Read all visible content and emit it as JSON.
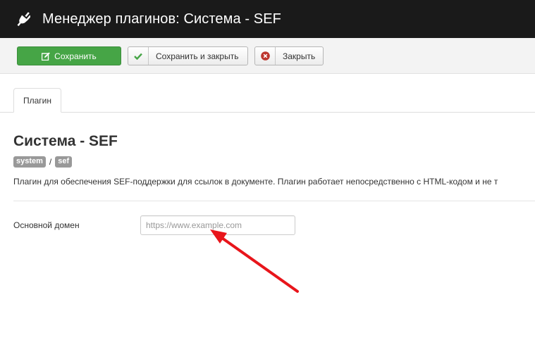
{
  "header": {
    "title": "Менеджер плагинов: Система - SEF",
    "icon": "plug-icon"
  },
  "toolbar": {
    "save_label": "Сохранить",
    "save_close_label": "Сохранить и закрыть",
    "close_label": "Закрыть"
  },
  "tabs": [
    {
      "label": "Плагин"
    }
  ],
  "plugin": {
    "title": "Система - SEF",
    "folder_tag": "system",
    "separator": "/",
    "element_tag": "sef",
    "description": "Плагин для обеспечения SEF-поддержки для ссылок в документе. Плагин работает непосредственно с HTML-кодом и не т"
  },
  "form": {
    "domain_label": "Основной домен",
    "domain_value": "",
    "domain_placeholder": "https://www.example.com"
  },
  "colors": {
    "header_bg": "#1a1a1a",
    "save_button": "#46a546",
    "close_icon": "#bd362f",
    "check_icon": "#46a546",
    "annotation_arrow": "#e8151b"
  }
}
